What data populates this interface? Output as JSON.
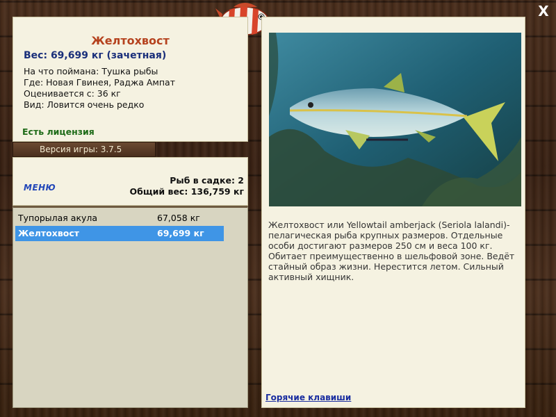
{
  "fish": {
    "name": "Желтохвост",
    "weight_line": "Вес: 69,699 кг (зачетная)",
    "bait": "На что поймана: Тушка рыбы",
    "location": "Где: Новая Гвинея, Раджа Ампат",
    "valued_from": "Оценивается с: 36 кг",
    "rarity": "Вид: Ловится очень редко",
    "license": "Есть лицензия",
    "description": "Желтохвост или Yellowtail amberjack (Seriola lalandi)-пелагическая рыба крупных размеров. Отдельные особи достигают размеров 250 см и веса 100 кг. Обитает преимущественно в шельфовой зоне. Ведёт стайный образ жизни. Нерестится летом. Сильный активный хищник."
  },
  "version": "Версия игры: 3.7.5",
  "summary": {
    "menu_label": "МЕНЮ",
    "count_line": "Рыб в садке: 2",
    "total_line": "Общий вес: 136,759 кг"
  },
  "catch_list": [
    {
      "name": "Тупорылая акула",
      "weight": "67,058 кг",
      "selected": false
    },
    {
      "name": "Желтохвост",
      "weight": "69,699 кг",
      "selected": true
    }
  ],
  "hotkeys_label": "Горячие клавиши",
  "close_label": "X",
  "colors": {
    "title": "#b5421e",
    "weight": "#1a2f7a",
    "license": "#1e6b18",
    "selection": "#3f95e6",
    "link": "#1a2ea0"
  }
}
